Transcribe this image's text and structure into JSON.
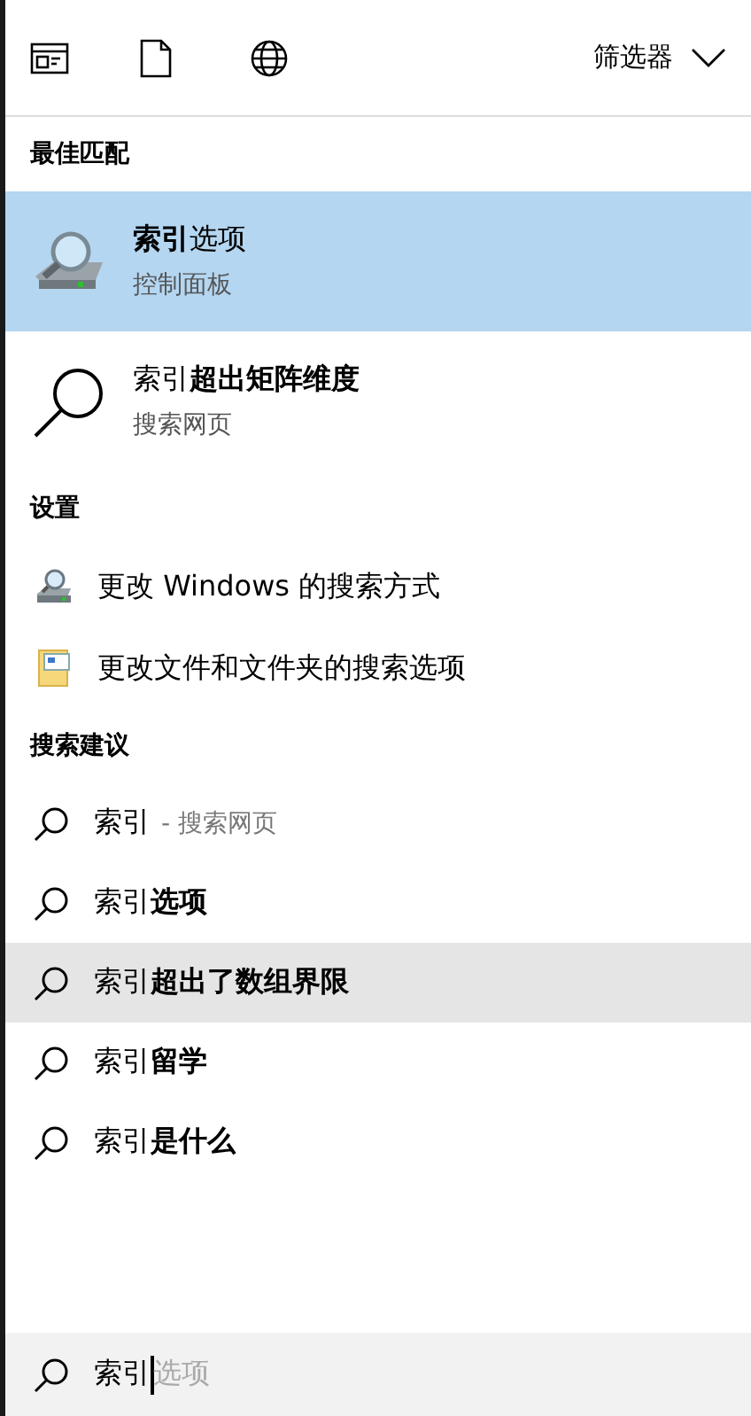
{
  "toolbar": {
    "filter_label": "筛选器"
  },
  "sections": [
    {
      "kind": "results",
      "title": "最佳匹配",
      "items": [
        {
          "kind": "app",
          "title": "**索引**选项",
          "subtitle": "控制面板",
          "selected": true
        },
        {
          "kind": "web",
          "title": "索引**超出矩阵维度**",
          "subtitle": "搜索网页",
          "selected": false
        }
      ]
    },
    {
      "kind": "settings",
      "title": "设置",
      "items": [
        {
          "kind": "search-settings",
          "title": "更改 Windows 的搜索方式"
        },
        {
          "kind": "folder-options",
          "title": "更改文件和文件夹的搜索选项"
        }
      ]
    },
    {
      "kind": "suggestions",
      "title": "搜索建议",
      "items": [
        {
          "text": "索引",
          "note": "- 搜索网页",
          "highlighted": false
        },
        {
          "text": "索引**选项**",
          "highlighted": false
        },
        {
          "text": "索引**超出了数组界限**",
          "highlighted": true
        },
        {
          "text": "索引**留学**",
          "highlighted": false
        },
        {
          "text": "索引**是什么**",
          "highlighted": false
        }
      ]
    }
  ],
  "search_box": {
    "value": "索引",
    "suggestion": "选项"
  }
}
